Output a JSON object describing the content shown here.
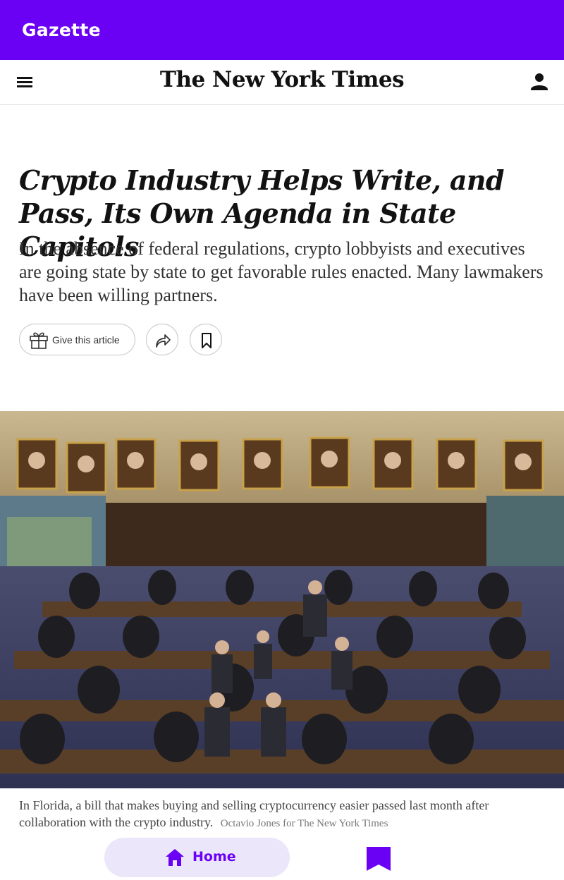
{
  "app": {
    "title": "Gazette"
  },
  "nyt_header": {
    "logo_text": "The New York Times",
    "menu_icon": "hamburger-menu-icon",
    "account_icon": "person-icon"
  },
  "article": {
    "headline": "Crypto Industry Helps Write, and Pass, Its Own Agenda in State Capitols",
    "summary": "In the absence of federal regulations, crypto lobbyists and executives are going state by state to get favorable rules enacted. Many lawmakers have been willing partners.",
    "actions": {
      "gift_label": "Give this article",
      "gift_icon": "gift-icon",
      "share_icon": "share-arrow-icon",
      "bookmark_icon": "bookmark-icon"
    },
    "photo": {
      "caption": "In Florida, a bill that makes buying and selling cryptocurrency easier passed last month after collaboration with the crypto industry.",
      "credit": "Octavio Jones for The New York Times"
    }
  },
  "bottom_nav": {
    "home_label": "Home",
    "home_icon": "home-icon",
    "saved_icon": "bookmark-icon",
    "accent_color": "#6a00f4",
    "pill_color": "#ece6fb"
  },
  "colors": {
    "app_bar": "#6a00f4",
    "text": "#121212"
  }
}
